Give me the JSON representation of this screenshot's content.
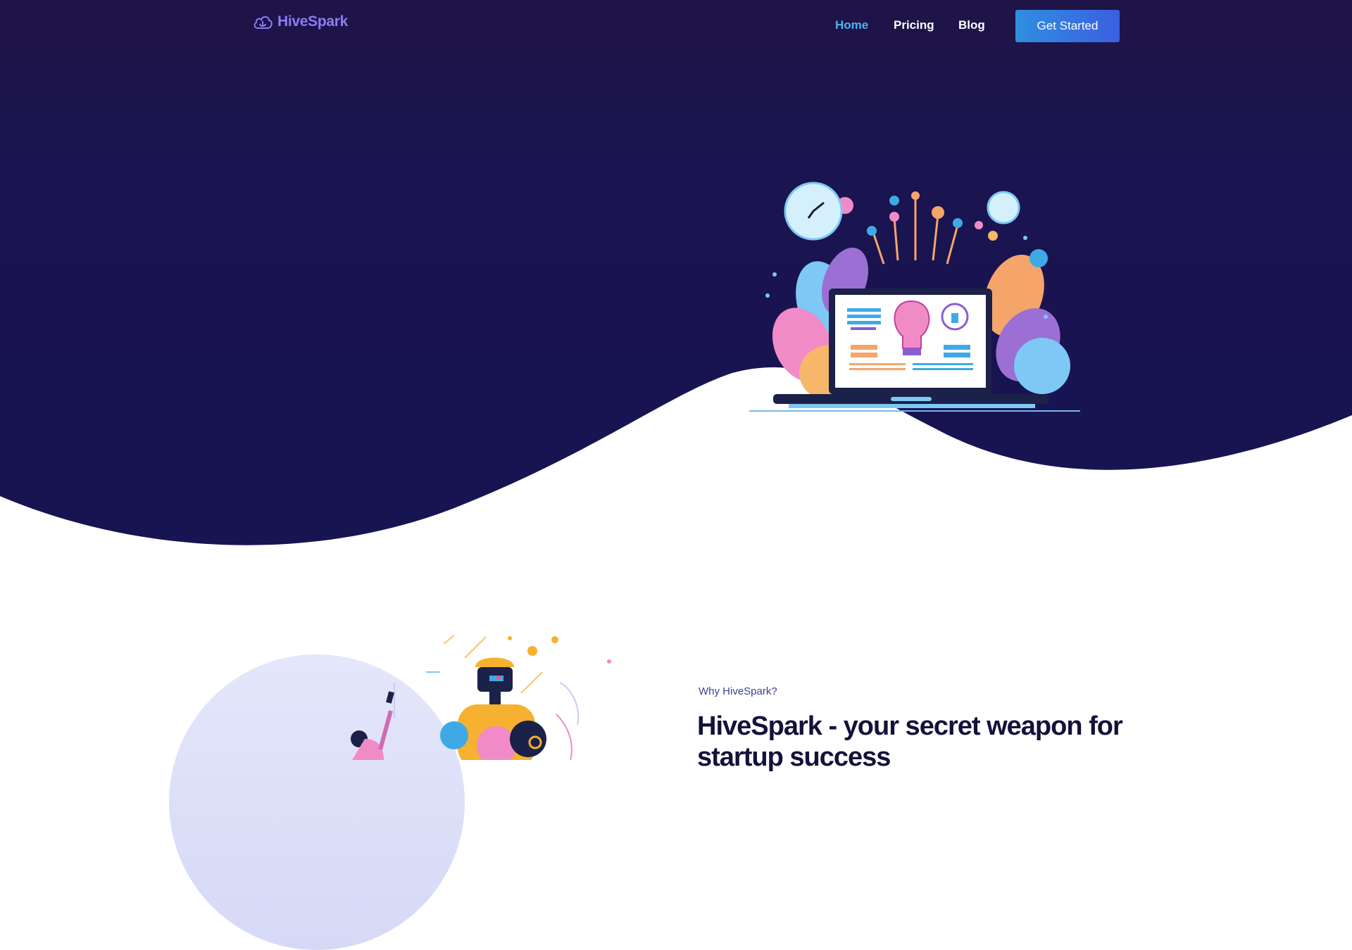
{
  "brand": {
    "name": "HiveSpark",
    "logo_icon": "cloud-icon",
    "color": "#8b7cf6"
  },
  "nav": {
    "links": [
      {
        "label": "Home",
        "active": true
      },
      {
        "label": "Pricing",
        "active": false
      },
      {
        "label": "Blog",
        "active": false
      }
    ],
    "cta_label": "Get Started"
  },
  "hero": {
    "illustration": "laptop-lightbulb-illustration"
  },
  "why": {
    "eyebrow": "Why HiveSpark?",
    "headline": "HiveSpark - your secret weapon for startup success"
  },
  "colors": {
    "hero_bg": "#1a1450",
    "active_link": "#4fb3f0",
    "cta_start": "#2f8ee0",
    "cta_end": "#3b5fe0",
    "headline": "#12123a"
  }
}
